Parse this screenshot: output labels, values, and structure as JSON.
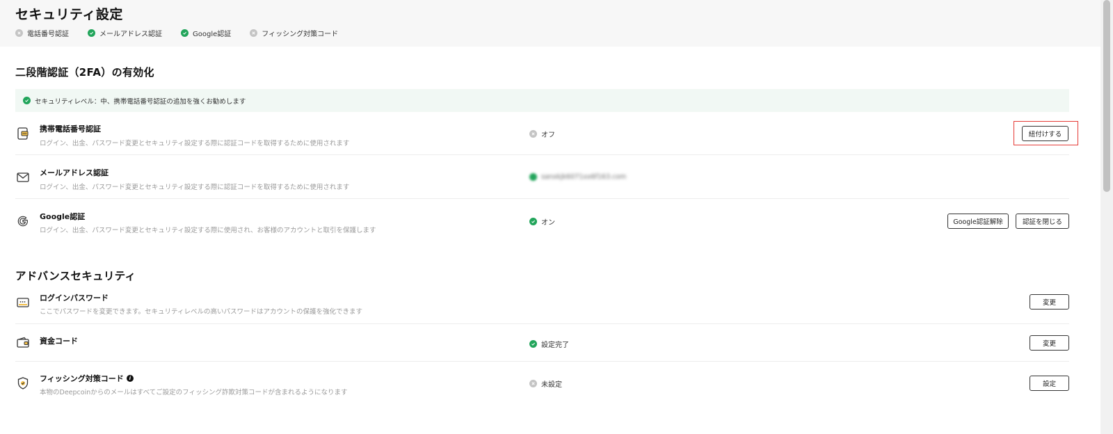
{
  "header": {
    "title": "セキュリティ設定",
    "statuses": [
      {
        "label": "電話番号認証",
        "state": "off"
      },
      {
        "label": "メールアドレス認証",
        "state": "ok"
      },
      {
        "label": "Google認証",
        "state": "ok"
      },
      {
        "label": "フィッシング対策コード",
        "state": "off"
      }
    ]
  },
  "twofa": {
    "title": "二段階認証（2FA）の有効化",
    "banner": "セキュリティレベル：中、携帯電話番号認証の追加を強くお勧めします",
    "items": [
      {
        "title": "携帯電話番号認証",
        "desc": "ログイン、出金、パスワード変更とセキュリティ設定する際に認証コードを取得するために使用されます",
        "status": "オフ",
        "bind_button": "紐付けする"
      },
      {
        "title": "メールアドレス認証",
        "desc": "ログイン、出金、パスワード変更とセキュリティ設定する際に認証コードを取得するために使用されます",
        "email": "sanxkjk6071xx6f163.com"
      },
      {
        "title": "Google認証",
        "desc": "ログイン、出金、パスワード変更とセキュリティ設定する際に使用され、お客様のアカウントと取引を保護します",
        "status": "オン",
        "unbind_button": "Google認証解除",
        "close_button": "認証を閉じる"
      }
    ]
  },
  "advanced": {
    "title": "アドバンスセキュリティ",
    "items": [
      {
        "title": "ログインパスワード",
        "desc": "ここでパスワードを変更できます。セキュリティレベルの高いパスワードはアカウントの保護を強化できます",
        "button": "変更"
      },
      {
        "title": "資金コード",
        "status": "設定完了",
        "button": "変更"
      },
      {
        "title": "フィッシング対策コード",
        "desc": "本物のDeepcoinからのメールはすべてご設定のフィッシング詐欺対策コードが含まれるようになります",
        "status": "未設定",
        "button": "設定"
      }
    ]
  },
  "colors": {
    "ok": "#22a55b",
    "off": "#c4c4c4",
    "highlight": "#e53935"
  }
}
